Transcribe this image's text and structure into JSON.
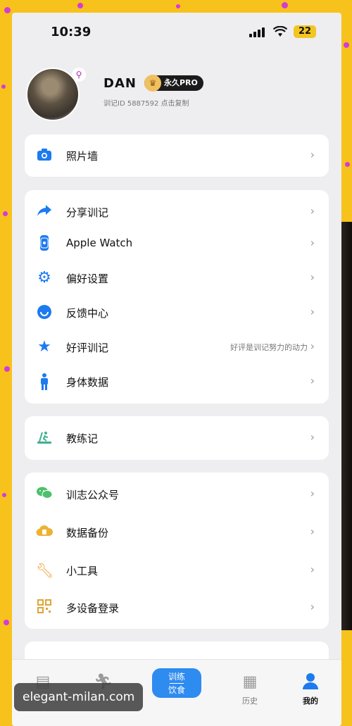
{
  "status": {
    "time": "10:39",
    "battery": "22"
  },
  "profile": {
    "username": "DAN",
    "badge": "永久PRO",
    "user_id": "训记ID 5887592 点击复制"
  },
  "section1": [
    {
      "icon": "camera-icon",
      "label": "照片墙"
    }
  ],
  "section2": [
    {
      "icon": "share-icon",
      "label": "分享训记"
    },
    {
      "icon": "watch-icon",
      "label": "Apple Watch"
    },
    {
      "icon": "gear-icon",
      "label": "偏好设置"
    },
    {
      "icon": "smile-icon",
      "label": "反馈中心"
    },
    {
      "icon": "star-icon",
      "label": "好评训记",
      "hint": "好评是训记努力的动力"
    },
    {
      "icon": "person-icon",
      "label": "身体数据"
    }
  ],
  "section3": [
    {
      "icon": "treadmill-icon",
      "label": "教练记"
    }
  ],
  "section4": [
    {
      "icon": "wechat-icon",
      "label": "训志公众号"
    },
    {
      "icon": "cloud-icon",
      "label": "数据备份"
    },
    {
      "icon": "wrench-icon",
      "label": "小工具"
    },
    {
      "icon": "qr-icon",
      "label": "多设备登录"
    }
  ],
  "tabbar": {
    "center_top": "训练",
    "center_bottom": "饮食",
    "history": "历史",
    "mine": "我的"
  },
  "watermark": "elegant-milan.com",
  "colors": {
    "accent": "#1D7BF0",
    "frame": "#F7C21B"
  }
}
